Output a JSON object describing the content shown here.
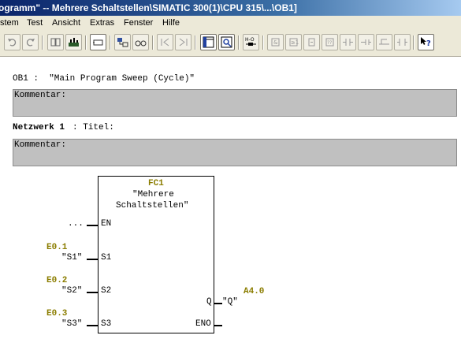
{
  "window": {
    "title": "ogramm\" -- Mehrere Schaltstellen\\SIMATIC 300(1)\\CPU 315\\...\\OB1]"
  },
  "menu": {
    "items": [
      "stem",
      "Test",
      "Ansicht",
      "Extras",
      "Fenster",
      "Hilfe"
    ]
  },
  "toolbar": {
    "buttons": [
      "undo-icon",
      "redo-icon",
      "compile-icon",
      "monitor-icon",
      "insert-network-icon",
      "block-icon",
      "glasses-icon",
      "first-network-icon",
      "last-network-icon",
      "overview-icon",
      "details-icon",
      "io-icon",
      "contact-and-icon",
      "contact-or-icon",
      "contact-icon",
      "comparison-icon",
      "branch-open-icon",
      "branch-close-icon",
      "coil-icon",
      "box-icon",
      "line-icon",
      "help-icon"
    ]
  },
  "editor": {
    "block_header": "OB1 :  \"Main Program Sweep (Cycle)\"",
    "block_comment_label": "Kommentar:",
    "network_label": "Netzwerk 1",
    "network_title": ": Titel:",
    "network_comment_label": "Kommentar:",
    "fc": {
      "name": "FC1",
      "title_line1": "\"Mehrere",
      "title_line2": "Schaltstellen\"",
      "en_input": "...",
      "inputs": [
        {
          "pin": "EN",
          "addr": "",
          "symbol": "..."
        },
        {
          "pin": "S1",
          "addr": "E0.1",
          "symbol": "\"S1\""
        },
        {
          "pin": "S2",
          "addr": "E0.2",
          "symbol": "\"S2\""
        },
        {
          "pin": "S3",
          "addr": "E0.3",
          "symbol": "\"S3\""
        }
      ],
      "outputs": [
        {
          "pin": "Q",
          "addr": "A4.0",
          "symbol": "\"Q\""
        },
        {
          "pin": "ENO",
          "addr": "",
          "symbol": ""
        }
      ]
    }
  }
}
